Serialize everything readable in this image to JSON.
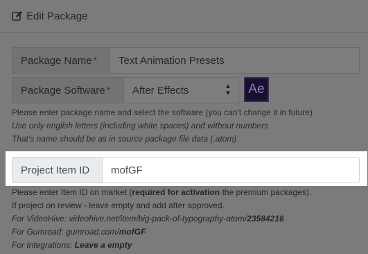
{
  "header": {
    "title": "Edit Package",
    "icon": "edit-icon"
  },
  "package_name": {
    "label": "Package Name",
    "required_mark": "*",
    "value": "Text Animation Presets"
  },
  "package_software": {
    "label": "Package Software",
    "required_mark": "*",
    "value": "After Effects",
    "logo_text": "Ae"
  },
  "help1": {
    "line1": "Please enter package name and select the software (you can't change it in future)",
    "line2": "Use only english letters (including white spaces) and without numbers",
    "line3": "That's name should be as in source package file data (.atom)"
  },
  "project_item": {
    "label": "Project Item ID",
    "value": "mofGF"
  },
  "help2": {
    "line1_pre": "Please enter Item ID on market (",
    "line1_bold": "required for activation",
    "line1_post": " the premium packages).",
    "line2": "If project on review - leave empty and add after approved.",
    "line3_pre": "For VideoHive: videohive.net/item/big-pack-of-typography-atom/",
    "line3_bold": "23584216",
    "line4_pre": "For Gumroad: gumroad.com/",
    "line4_bold": "mofGF",
    "line5_pre": "For Integrations: ",
    "line5_bold": "Leave a empty"
  }
}
